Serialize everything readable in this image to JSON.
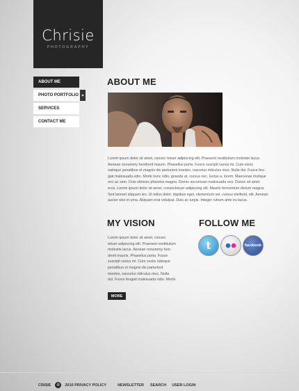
{
  "logo": {
    "title": "Chrisie",
    "subtitle": "PHOTOGRAPHY"
  },
  "nav": {
    "items": [
      {
        "label": "ABOUT ME"
      },
      {
        "label": "PHOTO PORTFOLIO"
      },
      {
        "label": "SERVICES"
      },
      {
        "label": "CONTACT ME"
      }
    ],
    "submenu_arrow": "▾"
  },
  "about": {
    "title": "ABOUT ME",
    "lines": [
      "Lorem ipsum dolor sit amet, consec tetuer adipiscing elit. Praesent vestibulum molestie lacus.",
      "Aenean nonummy hendrerit mauris. Phasellus porta. Fusce suscipit varius mi. Cum socis",
      "natoque penatibus et magnis dis parturient montes, nascetur ridiculus mus. Nulla dui. Fusce feu-",
      "giat malesuada odio. Morbi nunc odio, gravida at, cursus nec, luctus a, lorem. Maecenas tristique",
      "orci ac sem. Duis ultricies pharetra magna. Donec accumsan malesuada orci. Donec sit amet",
      "eros. Lorem ipsum dolor sit amet, consectetuer adipiscing elit. Mauris fermentum dictum magna.",
      "Sed laoreet aliquam leo. Ut tellus dolor, dapibus eget, elementum vel, cursus eleifend, elit. Aenean",
      "auctor wisi et urna. Aliquam erat volutpat. Duis ac turpis. Integer rutrum ante eu lacus."
    ]
  },
  "vision": {
    "title": "MY VISION",
    "lines": [
      "Lorem ipsum dolor sit amet, consec",
      "tetuer adipiscing elit. Praesent vestibulum",
      "molestie lacus. Aenean nonummy hen-",
      "drerit mauris. Phasellus porta. Fusce",
      "suscipit varius mi. Cum sociis natoque",
      "penatibus et magnis dis parturient",
      "montes, nascetur ridiculus mus. Nulla",
      "dui. Fusce feugiat malesuada odio. Morbi"
    ],
    "more_label": "MORE"
  },
  "follow": {
    "title": "FOLLOW ME",
    "networks": [
      {
        "name": "twitter",
        "label": "t"
      },
      {
        "name": "flickr",
        "label": ""
      },
      {
        "name": "facebook",
        "label": "facebook"
      }
    ]
  },
  "footer": {
    "brand": "CRISIE",
    "copy_symbol": "©",
    "policy": "2010 PRIVACY POLICY",
    "links": [
      "NEWSLETTER",
      "SEARCH",
      "USER LOGIN"
    ]
  }
}
